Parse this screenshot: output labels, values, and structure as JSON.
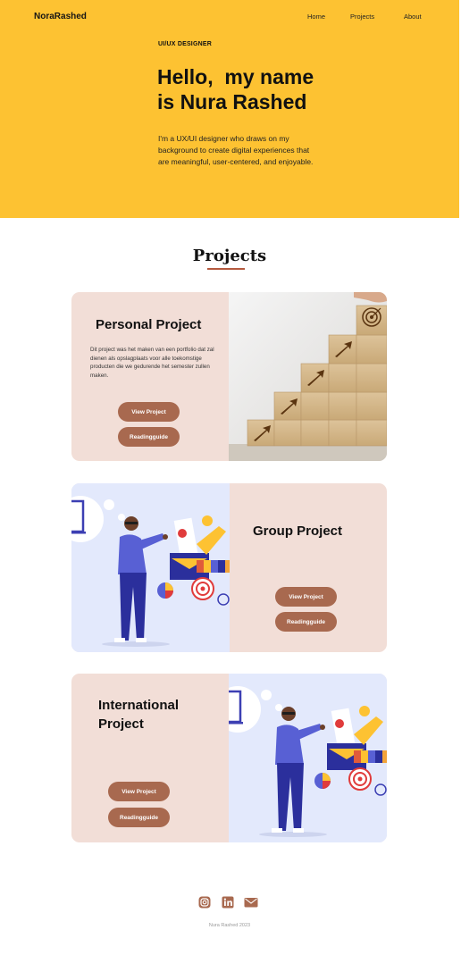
{
  "header": {
    "brand": "NoraRashed",
    "nav": [
      {
        "label": "Home"
      },
      {
        "label": "Projects"
      },
      {
        "label": "About"
      }
    ],
    "background": "#fdc232"
  },
  "hero": {
    "eyebrow": "UI/UX DESIGNER",
    "title_line1": "Hello,  my name",
    "title_line2": "is Nura Rashed",
    "description": "I'm a UX/UI designer who draws on my background to create digital experiences that are meaningful, user-centered, and enjoyable."
  },
  "projects": {
    "heading": "Projects",
    "accent": "#b55a3f",
    "card_background": "#f2ded7",
    "button_color": "#a8694f",
    "items": [
      {
        "title": "Personal Project",
        "description": "Dit project was het  maken van een portfolio dat zal dienen als opslagplaats voor alle toekomstige producten die we gedurende het semester zullen maken.",
        "view_label": "View Project",
        "guide_label": "Readingguide",
        "image": "wooden-blocks-stairs-target-image"
      },
      {
        "title": "Group Project",
        "view_label": "View Project",
        "guide_label": "Readingguide",
        "image": "designer-illustration"
      },
      {
        "title_line1": "International",
        "title_line2": "Project",
        "view_label": "View Project",
        "guide_label": "Readingguide",
        "image": "designer-illustration"
      }
    ]
  },
  "footer": {
    "icons": [
      "instagram-icon",
      "linkedin-icon",
      "mail-icon"
    ],
    "copyright": "Nura Rashed 2023"
  }
}
